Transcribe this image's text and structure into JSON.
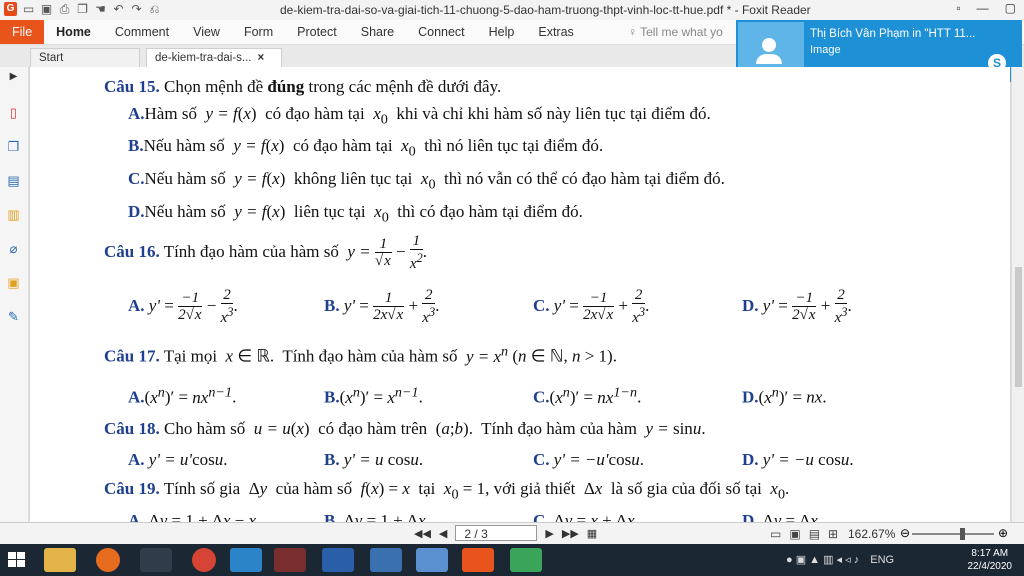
{
  "window": {
    "title": "de-kiem-tra-dai-so-va-giai-tich-11-chuong-5-dao-ham-truong-thpt-vinh-loc-tt-hue.pdf * - Foxit Reader"
  },
  "menu": [
    "File",
    "Home",
    "Comment",
    "View",
    "Form",
    "Protect",
    "Share",
    "Connect",
    "Help",
    "Extras"
  ],
  "search_placeholder": "Tell me what yo",
  "tabs": [
    {
      "label": "Start"
    },
    {
      "label": "de-kiem-tra-dai-s...",
      "close": "×"
    }
  ],
  "notification": {
    "title": "Thị Bích Vân Phạm in \"HTT 11...",
    "subtitle": "Image",
    "app_badge": "S"
  },
  "document": {
    "q15": {
      "label": "Câu 15.",
      "text": "Chọn mệnh đề",
      "bold_word": "đúng",
      "rest": "trong các mệnh đề dưới đây.",
      "A": {
        "label": "A.",
        "pre": "Hàm số",
        "mid": "có đạo hàm tại",
        "post": "khi và chỉ khi hàm số này liên tục tại điểm đó."
      },
      "B": {
        "label": "B.",
        "pre": "Nếu hàm số",
        "mid": "có đạo hàm tại",
        "post": "thì nó liên tục tại điểm đó."
      },
      "C": {
        "label": "C.",
        "pre": "Nếu hàm số",
        "mid": "không liên tục tại",
        "post": "thì nó vẫn có thể có đạo hàm tại điểm đó."
      },
      "D": {
        "label": "D.",
        "pre": "Nếu hàm số",
        "mid": "liên tục tại",
        "post": "thì có đạo hàm tại điểm đó."
      }
    },
    "q16": {
      "label": "Câu 16.",
      "text": "Tính đạo hàm của hàm số"
    },
    "q17": {
      "label": "Câu 17.",
      "pre": "Tại mọi",
      "mid": "Tính đạo hàm của hàm số"
    },
    "q18": {
      "label": "Câu 18.",
      "pre": "Cho hàm số",
      "mid": "có đạo hàm trên",
      "post": "Tính đạo hàm của hàm"
    },
    "q19": {
      "label": "Câu 19.",
      "pre": "Tính số gia",
      "mid1": "của hàm số",
      "mid2": "tại",
      "mid3": ", với giả thiết",
      "post": "là số gia của đối số tại"
    },
    "opt_labels": [
      "A.",
      "B.",
      "C.",
      "D."
    ]
  },
  "status": {
    "page": "2 / 3",
    "zoom": "162.67%"
  },
  "taskbar": {
    "time": "8:17 AM",
    "date": "22/4/2020",
    "lang": "ENG"
  }
}
